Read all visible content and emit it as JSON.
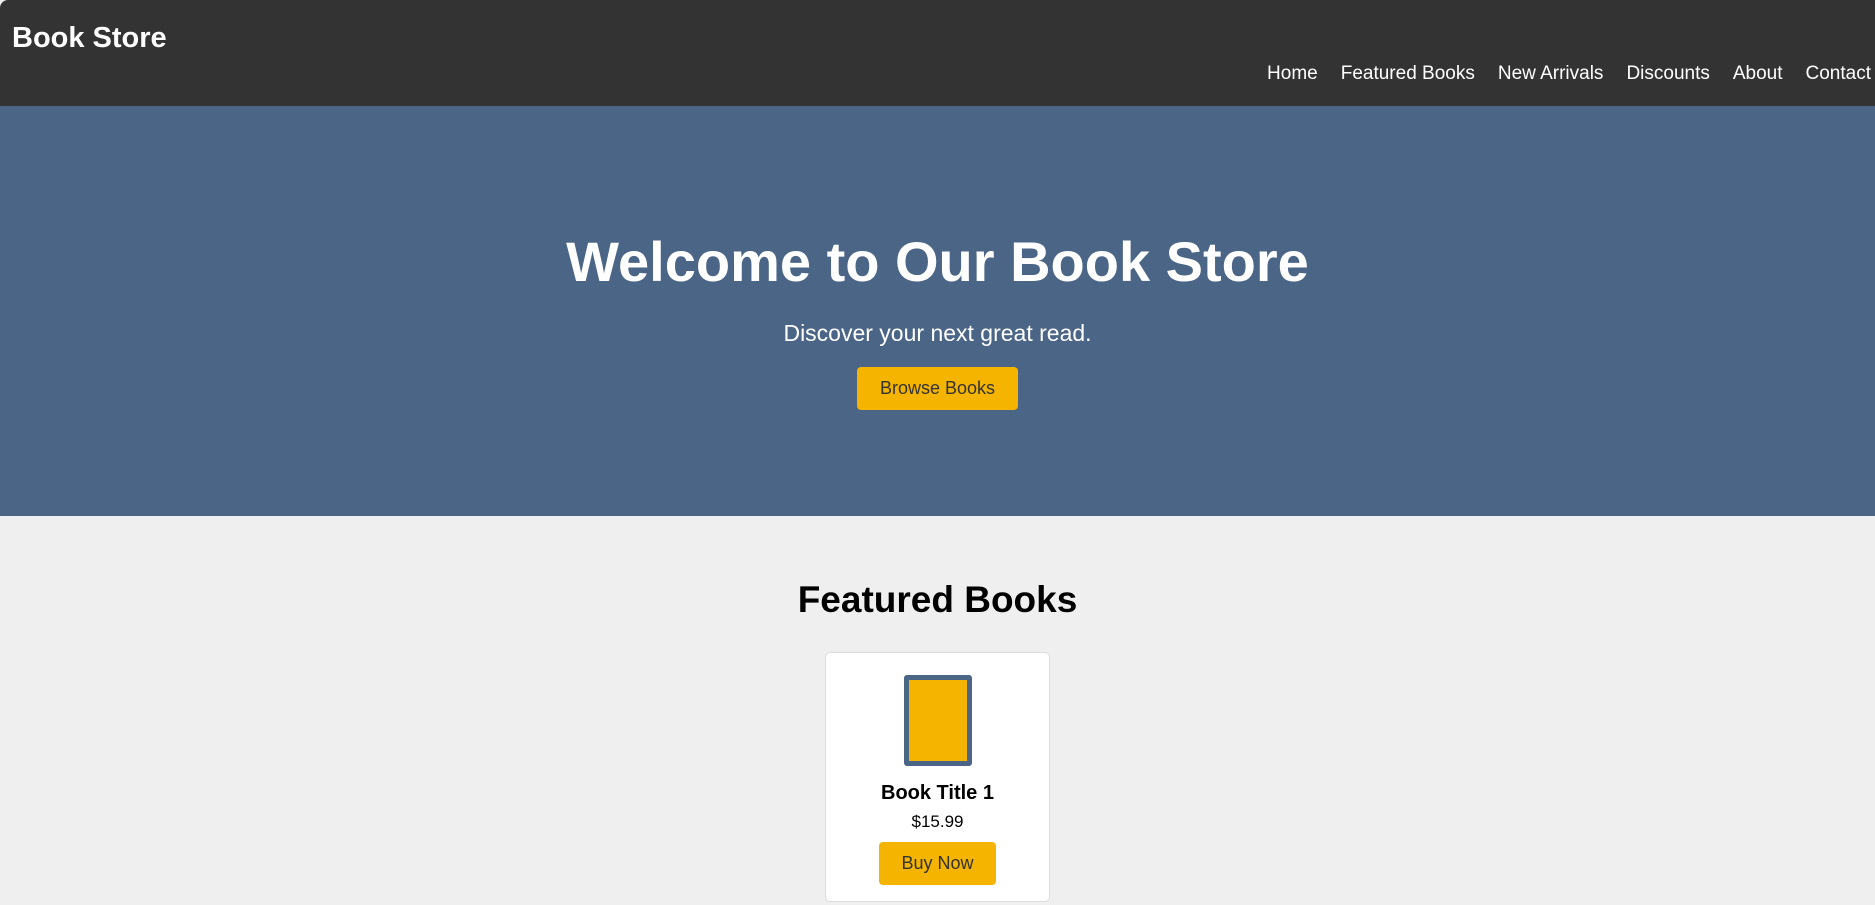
{
  "header": {
    "brand": "Book Store",
    "nav": [
      "Home",
      "Featured Books",
      "New Arrivals",
      "Discounts",
      "About",
      "Contact"
    ]
  },
  "hero": {
    "title": "Welcome to Our Book Store",
    "subtitle": "Discover your next great read.",
    "button_label": "Browse Books"
  },
  "featured": {
    "title": "Featured Books",
    "books": [
      {
        "title": "Book Title 1",
        "price": "$15.99",
        "button_label": "Buy Now",
        "cover_icon": "book-cover-icon"
      }
    ]
  },
  "colors": {
    "header_bg": "#333333",
    "hero_bg": "#4a6586",
    "accent": "#f4b400",
    "page_bg": "#efefef"
  }
}
